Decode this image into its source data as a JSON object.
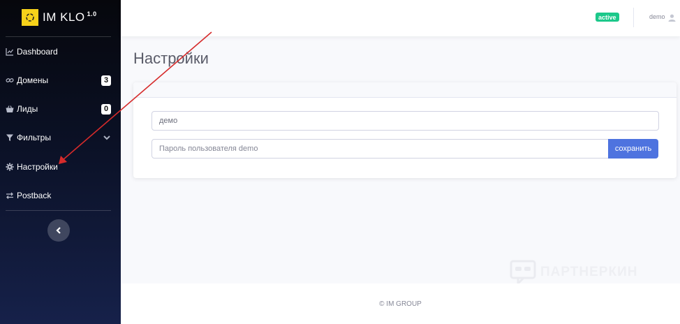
{
  "brand": {
    "name": "IM KLO",
    "version": "1.0"
  },
  "sidebar": {
    "items": [
      {
        "label": "Dashboard",
        "icon": "chart-line-icon"
      },
      {
        "label": "Домены",
        "icon": "link-icon",
        "badge": "3"
      },
      {
        "label": "Лиды",
        "icon": "basket-icon",
        "badge": "0"
      },
      {
        "label": "Фильтры",
        "icon": "filter-icon"
      },
      {
        "label": "Настройки",
        "icon": "gear-icon"
      },
      {
        "label": "Postback",
        "icon": "exchange-icon"
      }
    ]
  },
  "topbar": {
    "status": "active",
    "user": "demo"
  },
  "main": {
    "title": "Настройки",
    "username_value": "демо",
    "password_placeholder": "Пароль пользователя demo",
    "save_label": "сохранить"
  },
  "footer": {
    "text": "© IM GROUP"
  },
  "watermark": {
    "text": "ПАРТНЕРКИН"
  },
  "colors": {
    "accent": "#4e73df",
    "status": "#1cc88a",
    "logo": "#f7d21a",
    "annotation": "#d62b2b"
  }
}
